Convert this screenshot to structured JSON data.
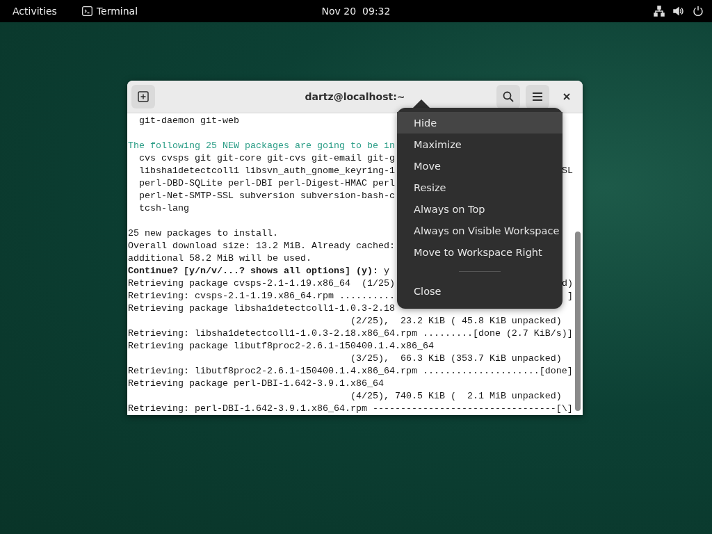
{
  "top_bar": {
    "activities": "Activities",
    "app": {
      "label": "Terminal"
    },
    "clock": "Nov 20  09:32"
  },
  "window": {
    "title": "dartz@localhost:~",
    "lines": [
      {
        "text": "  git-daemon git-web",
        "kind": "plain"
      },
      {
        "kind": "blank"
      },
      {
        "text": "The following 25 NEW packages are going to be in",
        "kind": "notice"
      },
      {
        "text": "  cvs cvsps git git-core git-cvs git-email git-g",
        "kind": "plain"
      },
      {
        "text": "  libsha1detectcoll1 libsvn_auth_gnome_keyring-1",
        "tail": "SL",
        "kind": "plain"
      },
      {
        "text": "  perl-DBD-SQLite perl-DBI perl-Digest-HMAC perl",
        "kind": "plain"
      },
      {
        "text": "  perl-Net-SMTP-SSL subversion subversion-bash-c",
        "kind": "plain"
      },
      {
        "text": "  tcsh-lang",
        "kind": "plain"
      },
      {
        "kind": "blank"
      },
      {
        "text": "25 new packages to install.",
        "kind": "plain"
      },
      {
        "text": "Overall download size: 13.2 MiB. Already cached:",
        "kind": "plain"
      },
      {
        "text": "additional 58.2 MiB will be used.",
        "kind": "plain"
      },
      {
        "text": "**Continue? [y/n/v/...? shows all options] (y):** y",
        "kind": "plain"
      },
      {
        "text": "Retrieving package cvsps-2.1-1.19.x86_64  (1/25)",
        "tail": "d)",
        "kind": "plain"
      },
      {
        "text": "Retrieving: cvsps-2.1-1.19.x86_64.rpm ..........",
        "tail": "]",
        "kind": "plain"
      },
      {
        "text": "Retrieving package libsha1detectcoll1-1.0.3-2.18",
        "kind": "plain"
      },
      {
        "text": "                                        (2/25),  23.2 KiB ( 45.8 KiB unpacked)",
        "kind": "plain"
      },
      {
        "text": "Retrieving: libsha1detectcoll1-1.0.3-2.18.x86_64.rpm .........[done (2.7 KiB/s)]",
        "kind": "plain"
      },
      {
        "text": "Retrieving package libutf8proc2-2.6.1-150400.1.4.x86_64",
        "kind": "plain"
      },
      {
        "text": "                                        (3/25),  66.3 KiB (353.7 KiB unpacked)",
        "kind": "plain"
      },
      {
        "text": "Retrieving: libutf8proc2-2.6.1-150400.1.4.x86_64.rpm .....................[done]",
        "kind": "plain"
      },
      {
        "text": "Retrieving package perl-DBI-1.642-3.9.1.x86_64",
        "kind": "plain"
      },
      {
        "text": "                                        (4/25), 740.5 KiB (  2.1 MiB unpacked)",
        "kind": "plain"
      },
      {
        "text": "Retrieving: perl-DBI-1.642-3.9.1.x86_64.rpm ---------------------------------[\\]",
        "kind": "plain"
      }
    ]
  },
  "menu": {
    "items": [
      {
        "label": "Hide",
        "selected": true,
        "kind": "item"
      },
      {
        "label": "Maximize",
        "selected": false,
        "kind": "item"
      },
      {
        "label": "Move",
        "selected": false,
        "kind": "item"
      },
      {
        "label": "Resize",
        "selected": false,
        "kind": "item"
      },
      {
        "label": "Always on Top",
        "selected": false,
        "kind": "item"
      },
      {
        "label": "Always on Visible Workspace",
        "selected": false,
        "kind": "item"
      },
      {
        "label": "Move to Workspace Right",
        "selected": false,
        "kind": "item"
      },
      {
        "kind": "separator"
      },
      {
        "label": "Close",
        "selected": false,
        "kind": "item"
      }
    ]
  }
}
